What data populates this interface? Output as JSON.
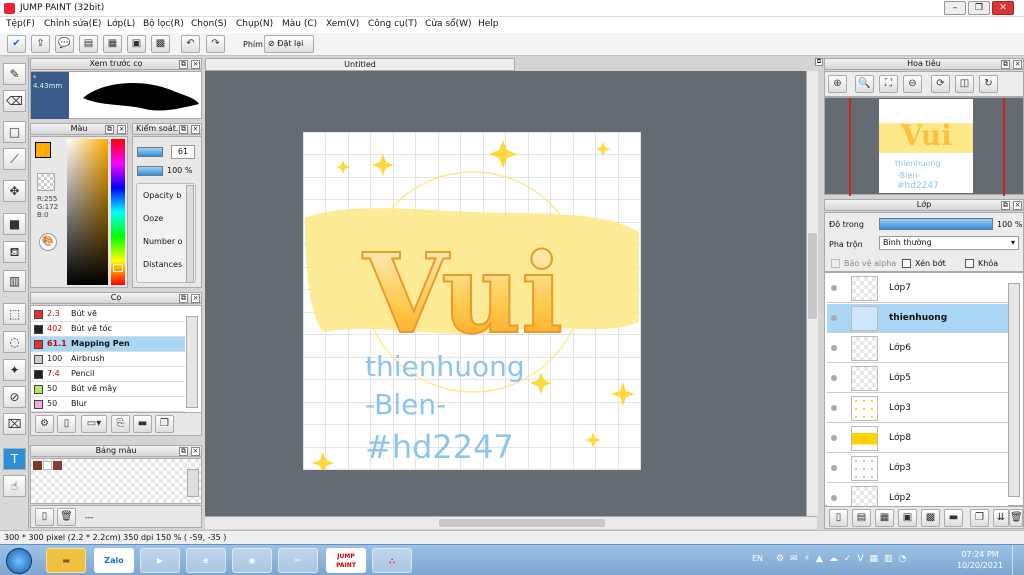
{
  "window": {
    "title": "JUMP PAINT (32bit)"
  },
  "menu": [
    "Tệp(F)",
    "Chỉnh sửa(E)",
    "Lớp(L)",
    "Bộ lọc(R)",
    "Chọn(S)",
    "Chụp(N)",
    "Màu (C)",
    "Xem(V)",
    "Công cụ(T)",
    "Cửa sổ(W)",
    "Help"
  ],
  "toolbar": {
    "mode_label": "Phím",
    "reset_label": "Đặt lại"
  },
  "brush_preview": {
    "title": "Xem trước cọ",
    "size": "* 4.43mm"
  },
  "color_panel": {
    "title": "Màu",
    "r": "R:255",
    "g": "G:172",
    "b": "B:0",
    "main_color": "#ffac00"
  },
  "control_panel": {
    "title": "Kiểm soát...",
    "size_value": "61",
    "opacity_value": "100 %",
    "options": [
      "Opacity b",
      "Ooze",
      "Number o",
      "Distances"
    ]
  },
  "brush_panel": {
    "title": "Cọ",
    "brushes": [
      {
        "size": "2.3",
        "name": "Bút vẽ",
        "color": "#e83030"
      },
      {
        "size": "402",
        "name": "Bút vẽ tóc",
        "color": "#222222"
      },
      {
        "size": "61.1",
        "name": "Mapping Pen",
        "color": "#e83030"
      },
      {
        "size": "100",
        "name": "Airbrush",
        "color": "#cccccc"
      },
      {
        "size": "7.4",
        "name": "Pencil",
        "color": "#222222"
      },
      {
        "size": "50",
        "name": "Bút vẽ mây",
        "color": "#b4e66a"
      },
      {
        "size": "50",
        "name": "Blur",
        "color": "#f4a8e0"
      }
    ]
  },
  "palette_panel": {
    "title": "Bảng màu",
    "footer": "---",
    "swatches": [
      "#7a3b1e",
      "#ffffff",
      "#8b3a3a"
    ]
  },
  "document": {
    "title": "Untitled"
  },
  "artwork": {
    "word": "Vui",
    "line1": "thienhuong",
    "line2": "-Blen-",
    "line3": "#hd2247"
  },
  "navigator": {
    "title": "Hoa tiêu"
  },
  "layer_panel": {
    "title": "Lớp",
    "opacity_label": "Độ trong",
    "opacity_value": "100 %",
    "blend_label": "Pha trộn",
    "blend_value": "Bình thường",
    "protect_alpha": "Bảo vệ alpha",
    "clipping": "Xén bớt",
    "lock": "Khóa",
    "layers": [
      {
        "name": "Lớp7",
        "selected": false
      },
      {
        "name": "thienhuong",
        "selected": true
      },
      {
        "name": "Lớp6",
        "selected": false
      },
      {
        "name": "Lớp5",
        "selected": false
      },
      {
        "name": "Lớp3",
        "selected": false
      },
      {
        "name": "Lớp8",
        "selected": false
      },
      {
        "name": "Lớp3",
        "selected": false
      },
      {
        "name": "Lớp2",
        "selected": false
      }
    ]
  },
  "status": {
    "text": "300 * 300 pixel  (2.2 * 2.2cm)  350 dpi  150 %  ( -59, -35 )"
  },
  "taskbar": {
    "lang": "EN",
    "time": "07:24 PM",
    "date": "10/20/2021",
    "apps": [
      "Zalo",
      "JUMP PAINT"
    ]
  }
}
